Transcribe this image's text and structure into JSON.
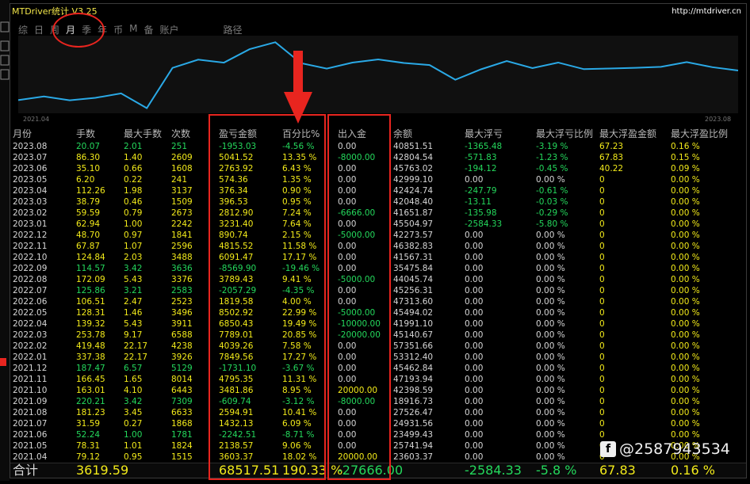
{
  "app": {
    "title": "MTDriver统计  V3.25",
    "site": "http://mtdriver.cn"
  },
  "nav": [
    "综",
    "日",
    "周",
    "月",
    "季",
    "年",
    "币",
    "M",
    "备",
    "账户",
    "路径"
  ],
  "nav_active": "月",
  "chart": {
    "start_label": "2021.04",
    "end_label": "2023.08",
    "line_color": "#2aa9e6",
    "points": [
      23603.37,
      25741.94,
      23499.43,
      24931.56,
      27526.47,
      18916.73,
      42398.59,
      47193.94,
      45462.84,
      53312.4,
      57351.66,
      45140.67,
      41991.1,
      45494.02,
      47313.6,
      45256.31,
      44045.74,
      35475.84,
      41567.31,
      46382.83,
      42273.57,
      45504.97,
      41651.87,
      42048.4,
      42424.74,
      42999.1,
      45763.02,
      42804.54,
      40851.51
    ]
  },
  "table": {
    "headers": [
      "月份",
      "手数",
      "最大手数",
      "次数",
      "盈亏金额",
      "百分比%",
      "出入金",
      "余额",
      "最大浮亏",
      "最大浮亏比例",
      "最大浮盈金额",
      "最大浮盈比例"
    ],
    "rows": [
      [
        "2023.08",
        "20.07",
        "2.01",
        "251",
        "-1953.03",
        "-4.56 %",
        "0.00",
        "40851.51",
        "-1365.48",
        "-3.19 %",
        "67.23",
        "0.16 %"
      ],
      [
        "2023.07",
        "86.30",
        "1.40",
        "2609",
        "5041.52",
        "13.35 %",
        "-8000.00",
        "42804.54",
        "-571.83",
        "-1.23 %",
        "67.83",
        "0.15 %"
      ],
      [
        "2023.06",
        "35.10",
        "0.66",
        "1608",
        "2763.92",
        "6.43 %",
        "0.00",
        "45763.02",
        "-194.12",
        "-0.45 %",
        "40.22",
        "0.09 %"
      ],
      [
        "2023.05",
        "6.20",
        "0.22",
        "241",
        "574.36",
        "1.35 %",
        "0.00",
        "42999.10",
        "0.00",
        "0.00 %",
        "0",
        "0.00 %"
      ],
      [
        "2023.04",
        "112.26",
        "1.98",
        "3137",
        "376.34",
        "0.90 %",
        "0.00",
        "42424.74",
        "-247.79",
        "-0.61 %",
        "0",
        "0.00 %"
      ],
      [
        "2023.03",
        "38.79",
        "0.46",
        "1509",
        "396.53",
        "0.95 %",
        "0.00",
        "42048.40",
        "-13.11",
        "-0.03 %",
        "0",
        "0.00 %"
      ],
      [
        "2023.02",
        "59.59",
        "0.79",
        "2673",
        "2812.90",
        "7.24 %",
        "-6666.00",
        "41651.87",
        "-135.98",
        "-0.29 %",
        "0",
        "0.00 %"
      ],
      [
        "2023.01",
        "62.94",
        "1.00",
        "2242",
        "3231.40",
        "7.64 %",
        "0.00",
        "45504.97",
        "-2584.33",
        "-5.80 %",
        "0",
        "0.00 %"
      ],
      [
        "2022.12",
        "48.70",
        "0.97",
        "1841",
        "890.74",
        "2.15 %",
        "-5000.00",
        "42273.57",
        "0.00",
        "0.00 %",
        "0",
        "0.00 %"
      ],
      [
        "2022.11",
        "67.87",
        "1.07",
        "2596",
        "4815.52",
        "11.58 %",
        "0.00",
        "46382.83",
        "0.00",
        "0.00 %",
        "0",
        "0.00 %"
      ],
      [
        "2022.10",
        "124.84",
        "2.03",
        "3488",
        "6091.47",
        "17.17 %",
        "0.00",
        "41567.31",
        "0.00",
        "0.00 %",
        "0",
        "0.00 %"
      ],
      [
        "2022.09",
        "114.57",
        "3.42",
        "3636",
        "-8569.90",
        "-19.46 %",
        "0.00",
        "35475.84",
        "0.00",
        "0.00 %",
        "0",
        "0.00 %"
      ],
      [
        "2022.08",
        "172.09",
        "5.43",
        "3376",
        "3789.43",
        "9.41 %",
        "-5000.00",
        "44045.74",
        "0.00",
        "0.00 %",
        "0",
        "0.00 %"
      ],
      [
        "2022.07",
        "125.86",
        "3.21",
        "2583",
        "-2057.29",
        "-4.35 %",
        "0.00",
        "45256.31",
        "0.00",
        "0.00 %",
        "0",
        "0.00 %"
      ],
      [
        "2022.06",
        "106.51",
        "2.47",
        "2523",
        "1819.58",
        "4.00 %",
        "0.00",
        "47313.60",
        "0.00",
        "0.00 %",
        "0",
        "0.00 %"
      ],
      [
        "2022.05",
        "128.31",
        "1.46",
        "3496",
        "8502.92",
        "22.99 %",
        "-5000.00",
        "45494.02",
        "0.00",
        "0.00 %",
        "0",
        "0.00 %"
      ],
      [
        "2022.04",
        "139.32",
        "5.43",
        "3911",
        "6850.43",
        "19.49 %",
        "-10000.00",
        "41991.10",
        "0.00",
        "0.00 %",
        "0",
        "0.00 %"
      ],
      [
        "2022.03",
        "253.78",
        "9.17",
        "6588",
        "7789.01",
        "20.85 %",
        "-20000.00",
        "45140.67",
        "0.00",
        "0.00 %",
        "0",
        "0.00 %"
      ],
      [
        "2022.02",
        "419.48",
        "22.17",
        "4238",
        "4039.26",
        "7.58 %",
        "0.00",
        "57351.66",
        "0.00",
        "0.00 %",
        "0",
        "0.00 %"
      ],
      [
        "2022.01",
        "337.38",
        "22.17",
        "3926",
        "7849.56",
        "17.27 %",
        "0.00",
        "53312.40",
        "0.00",
        "0.00 %",
        "0",
        "0.00 %"
      ],
      [
        "2021.12",
        "187.47",
        "6.57",
        "5129",
        "-1731.10",
        "-3.67 %",
        "0.00",
        "45462.84",
        "0.00",
        "0.00 %",
        "0",
        "0.00 %"
      ],
      [
        "2021.11",
        "166.45",
        "1.65",
        "8014",
        "4795.35",
        "11.31 %",
        "0.00",
        "47193.94",
        "0.00",
        "0.00 %",
        "0",
        "0.00 %"
      ],
      [
        "2021.10",
        "163.01",
        "4.10",
        "6443",
        "3481.86",
        "8.95 %",
        "20000.00",
        "42398.59",
        "0.00",
        "0.00 %",
        "0",
        "0.00 %"
      ],
      [
        "2021.09",
        "220.21",
        "3.42",
        "7309",
        "-609.74",
        "-3.12 %",
        "-8000.00",
        "18916.73",
        "0.00",
        "0.00 %",
        "0",
        "0.00 %"
      ],
      [
        "2021.08",
        "181.23",
        "3.45",
        "6633",
        "2594.91",
        "10.41 %",
        "0.00",
        "27526.47",
        "0.00",
        "0.00 %",
        "0",
        "0.00 %"
      ],
      [
        "2021.07",
        "31.59",
        "0.27",
        "1868",
        "1432.13",
        "6.09 %",
        "0.00",
        "24931.56",
        "0.00",
        "0.00 %",
        "0",
        "0.00 %"
      ],
      [
        "2021.06",
        "52.24",
        "1.00",
        "1781",
        "-2242.51",
        "-8.71 %",
        "0.00",
        "23499.43",
        "0.00",
        "0.00 %",
        "0",
        "0.00 %"
      ],
      [
        "2021.05",
        "78.31",
        "1.01",
        "1824",
        "2138.57",
        "9.06 %",
        "0.00",
        "25741.94",
        "0.00",
        "0.00 %",
        "0",
        "0.00 %"
      ],
      [
        "2021.04",
        "79.12",
        "0.95",
        "1515",
        "3603.37",
        "18.02 %",
        "20000.00",
        "23603.37",
        "0.00",
        "0.00 %",
        "0",
        "0.00 %"
      ]
    ],
    "total": [
      "合计",
      "3619.59",
      "",
      "",
      "68517.51",
      "190.33 %",
      "-27666.00",
      "",
      "-2584.33",
      "-5.8 %",
      "67.83",
      "0.16 %"
    ]
  },
  "watermark": "@2587943534",
  "colors": {
    "neg": "#24d85c",
    "pos": "#f2ea1a",
    "annot": "#e8251f"
  }
}
